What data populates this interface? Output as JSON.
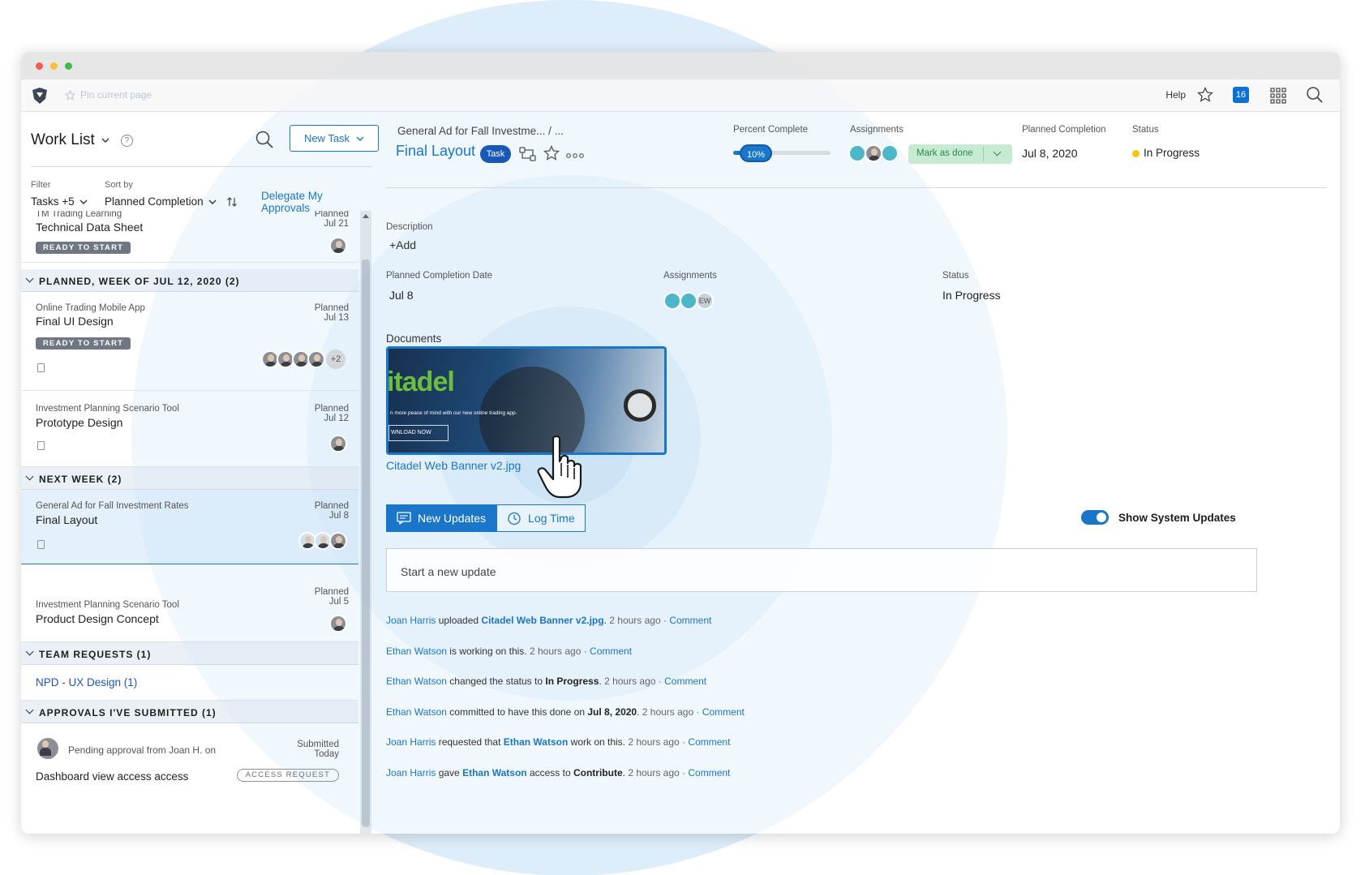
{
  "topbar": {
    "pin_label": "Pin current page",
    "help_label": "Help",
    "notifications_count": "16"
  },
  "worklist": {
    "title": "Work List",
    "new_task_label": "New Task",
    "filter_label": "Filter",
    "filter_value": "Tasks +5",
    "sort_label": "Sort by",
    "sort_value": "Planned Completion",
    "delegate_label": "Delegate My Approvals",
    "top_item": {
      "project": "TM Trading  Learning",
      "name": "Technical Data Sheet",
      "planned_label": "Planned",
      "planned_date": "Jul 21",
      "badge": "READY TO START"
    },
    "sections": [
      {
        "title": "PLANNED, WEEK OF JUL 12, 2020 (2)",
        "items": [
          {
            "project": "Online Trading Mobile App",
            "name": "Final UI Design",
            "planned_label": "Planned",
            "planned_date": "Jul 13",
            "badge": "READY TO START",
            "more": "+2"
          },
          {
            "project": "Investment Planning Scenario Tool",
            "name": "Prototype Design",
            "planned_label": "Planned",
            "planned_date": "Jul 12"
          }
        ]
      },
      {
        "title": "NEXT WEEK (2)",
        "items": [
          {
            "project": "General Ad for Fall Investment Rates",
            "name": "Final Layout",
            "planned_label": "Planned",
            "planned_date": "Jul 8"
          },
          {
            "project": "Investment Planning Scenario Tool",
            "name": "Product Design Concept",
            "planned_label": "Planned",
            "planned_date": "Jul 5"
          }
        ]
      },
      {
        "title": "TEAM REQUESTS (1)",
        "link": "NPD - UX Design (1)"
      },
      {
        "title": "APPROVALS I'VE SUBMITTED (1)",
        "item": {
          "text": "Pending approval from Joan H. on",
          "name": "Dashboard view access access",
          "submitted_label": "Submitted",
          "submitted_date": "Today",
          "badge": "ACCESS REQUEST"
        }
      }
    ]
  },
  "task": {
    "breadcrumb": "General Ad for Fall Investme...  /  ...",
    "title": "Final Layout",
    "type_pill": "Task",
    "percent_label": "Percent Complete",
    "percent_text": "10%",
    "percent_value": 10,
    "assignments_label": "Assignments",
    "mark_done_label": "Mark as done",
    "planned_label": "Planned Completion",
    "planned_value": "Jul 8, 2020",
    "status_label": "Status",
    "status_value": "In Progress",
    "status_color": "#f5c518",
    "description_label": "Description",
    "description_add": "+Add",
    "pcd_label": "Planned Completion Date",
    "pcd_value": "Jul 8",
    "assign2_label": "Assignments",
    "assign2_initials": "EW",
    "status2_label": "Status",
    "status2_value": "In Progress",
    "documents_label": "Documents",
    "document": {
      "name": "Citadel Web Banner  v2.jpg",
      "brand": "itadel",
      "tagline": "n more peace of mind with our new online trading app.",
      "button": "WNLOAD NOW"
    },
    "tab_updates": "New Updates",
    "tab_logtime": "Log Time",
    "system_updates_label": "Show System Updates",
    "update_placeholder": "Start a new update",
    "feed": [
      {
        "user": "Joan Harris",
        "action": " uploaded ",
        "target": "Citadel Web Banner v2.jpg",
        "target_style": "bl",
        "tail": ".",
        "time": "2 hours ago",
        "comment": "Comment"
      },
      {
        "user": "Ethan Watson",
        "action": " is working on this. ",
        "target": "",
        "target_style": "",
        "tail": "",
        "time": "2 hours ago",
        "comment": "Comment"
      },
      {
        "user": "Ethan Watson",
        "action": " changed the status to ",
        "target": "In Progress",
        "target_style": "b",
        "tail": ".",
        "time": "2 hours ago",
        "comment": "Comment"
      },
      {
        "user": "Ethan Watson",
        "action": " committed to have this done on ",
        "target": "Jul 8, 2020",
        "target_style": "b",
        "tail": ".",
        "time": "2 hours ago",
        "comment": "Comment"
      },
      {
        "user": "Joan Harris",
        "action": " requested that ",
        "target": "Ethan Watson",
        "target_style": "bl",
        "tail": " work on this.",
        "time": "2 hours ago",
        "comment": "Comment"
      },
      {
        "user": "Joan Harris",
        "action": " gave ",
        "target": "Ethan Watson",
        "target_style": "bl",
        "tail": " access to ",
        "extra": "Contribute",
        "extra_tail": ".",
        "time": "2 hours ago",
        "comment": "Comment"
      }
    ],
    "feed_separator": " · "
  },
  "colors": {
    "accent": "#1a76c9",
    "mark_done_bg": "#c7ebd2",
    "badge_gray": "#6f7782"
  }
}
